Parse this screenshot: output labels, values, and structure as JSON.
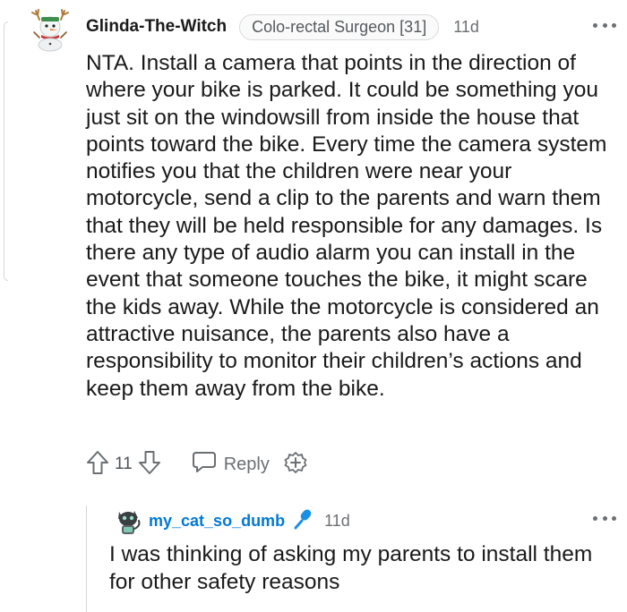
{
  "comment": {
    "username": "Glinda-The-Witch",
    "flair": "Colo-rectal Surgeon [31]",
    "time": "11d",
    "body": "NTA. Install a camera that points in the direction of where your bike is parked. It could be something you just sit on the windowsill from inside the house that points toward the bike. Every time the camera system notifies you that the children were near your motorcycle, send a clip to the parents and warn them that they will be held responsible for any damages. Is there any type of audio alarm you can install in the event that someone touches the bike, it might scare the kids away. While the motorcycle is considered an attractive nuisance, the parents also have a responsibility to monitor their children’s actions and keep them away from the bike.",
    "vote_count": "11",
    "reply_label": "Reply",
    "icons": [
      "snowman-avatar-icon",
      "more-options-icon",
      "upvote-icon",
      "downvote-icon",
      "reply-icon",
      "award-icon"
    ]
  },
  "reply": {
    "username": "my_cat_so_dumb",
    "time": "11d",
    "body": "I was thinking of asking my parents to install them for other safety reasons",
    "icons": [
      "cat-avatar-icon",
      "microphone-icon",
      "more-options-icon"
    ]
  },
  "colors": {
    "username_blue": "#0079d3",
    "text": "#1a1a1b",
    "meta": "#6b6f73"
  }
}
